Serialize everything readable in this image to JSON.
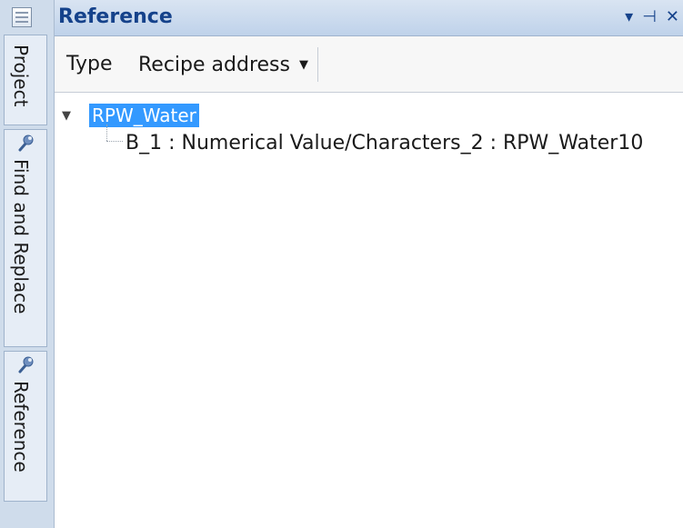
{
  "side_tabs": [
    {
      "label": "Project"
    },
    {
      "label": "Find and Replace"
    },
    {
      "label": "Reference"
    }
  ],
  "panel": {
    "title": "Reference",
    "controls": {
      "dropdown": "▾",
      "pin": "⊣",
      "close": "✕"
    }
  },
  "toolbar": {
    "type_label": "Type",
    "type_value": "Recipe address"
  },
  "tree": {
    "root": {
      "label": "RPW_Water",
      "expanded": true,
      "selected": true
    },
    "children": [
      {
        "label": "B_1 : Numerical Value/Characters_2 : RPW_Water10"
      }
    ]
  },
  "colors": {
    "title_text": "#15428b",
    "selection": "#3399ff",
    "side_strip": "#cfdceb"
  }
}
